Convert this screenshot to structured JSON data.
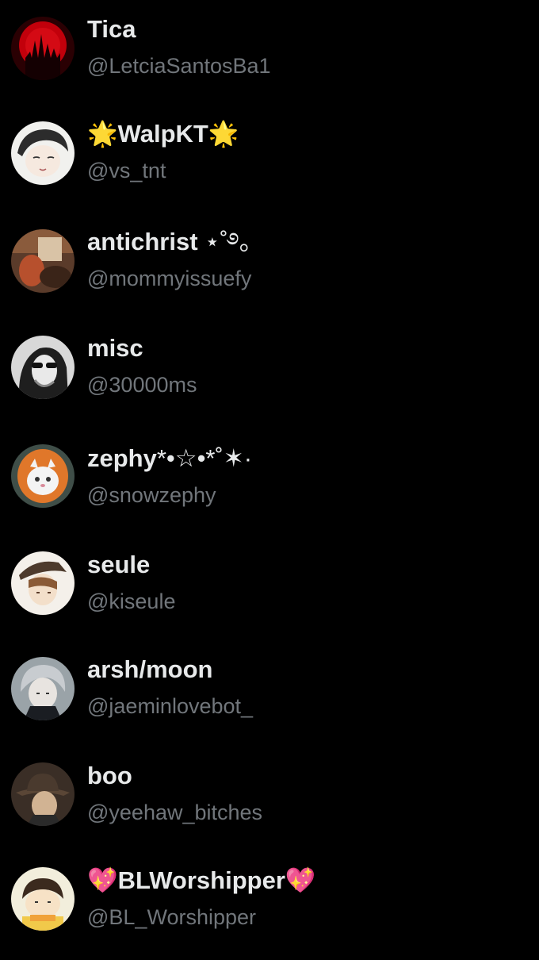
{
  "accounts": [
    {
      "name": "Tica",
      "handle": "@LetciaSantosBa1",
      "avatar_icon": "red-moon-castle-avatar"
    },
    {
      "name": "WalpKT",
      "name_prefix": "🌟",
      "name_suffix": "🌟",
      "handle": "@vs_tnt",
      "avatar_icon": "sleeping-anime-boy-avatar"
    },
    {
      "name": "antichrist",
      "name_suffix": " ⋆˚࿔。",
      "handle": "@mommyissuefy",
      "avatar_icon": "warm-toned-room-avatar"
    },
    {
      "name": "misc",
      "handle": "@30000ms",
      "avatar_icon": "sunglasses-portrait-avatar"
    },
    {
      "name": "zephy",
      "name_suffix": "*•☆•*˚✶·",
      "handle": "@snowzephy",
      "avatar_icon": "white-cat-orange-hood-avatar"
    },
    {
      "name": "seule",
      "handle": "@kiseule",
      "avatar_icon": "anime-hat-character-avatar"
    },
    {
      "name": "arsh/moon",
      "handle": "@jaeminlovebot_",
      "avatar_icon": "grey-haired-character-avatar"
    },
    {
      "name": "boo",
      "handle": "@yeehaw_bitches",
      "avatar_icon": "fedora-man-avatar"
    },
    {
      "name": "BLWorshipper",
      "name_prefix": "💖",
      "name_suffix": "💖",
      "handle": "@BL_Worshipper",
      "avatar_icon": "chibi-boy-avatar"
    }
  ],
  "colors": {
    "background": "#000000",
    "name_text": "#e7e9ea",
    "handle_text": "#71767b"
  }
}
